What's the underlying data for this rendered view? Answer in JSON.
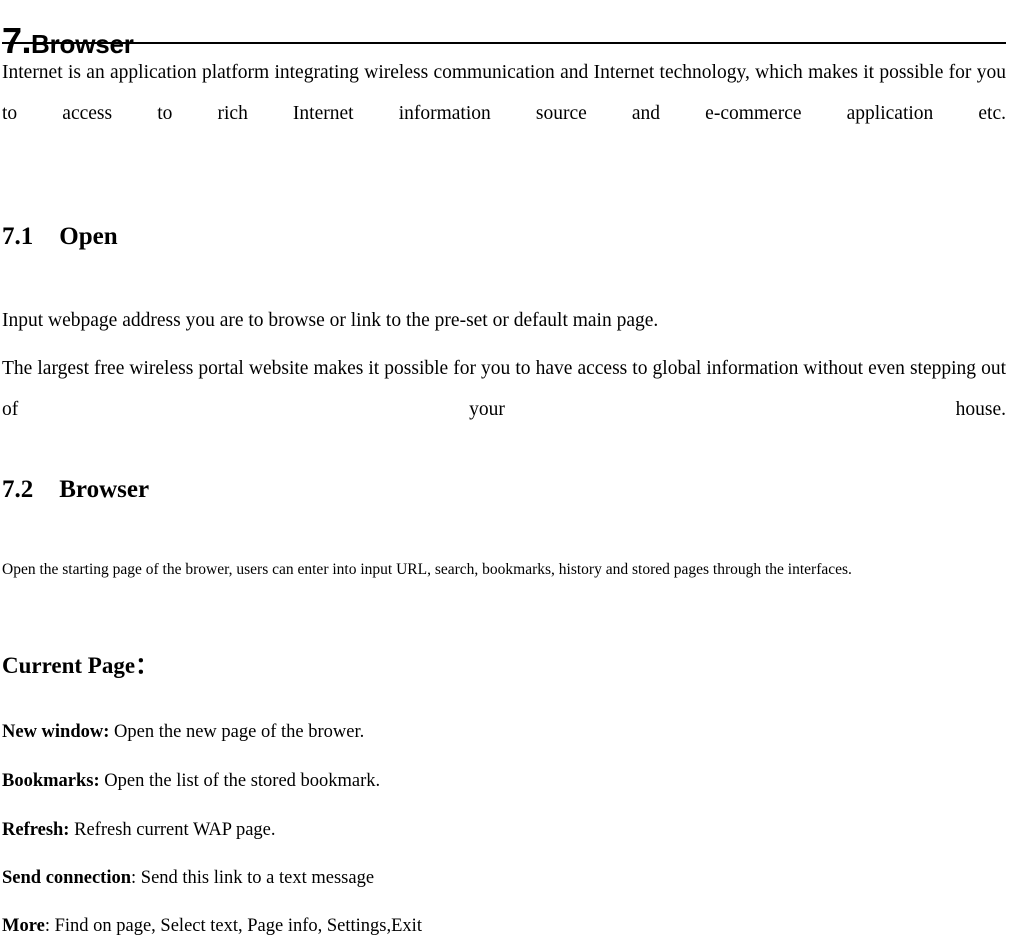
{
  "document": {
    "background_color": "#ffffff",
    "text_color": "#000000"
  },
  "chapter": {
    "number": "7.",
    "name": "Browser"
  },
  "intro_paragraph": "Internet is an application platform integrating wireless communication and Internet technology, which makes it possible for you to access to rich Internet information source and e-commerce application etc.",
  "sections": [
    {
      "number": "7.1",
      "title": "Open",
      "paragraphs": [
        "Input webpage address you are to browse or link to the pre-set or default main page.",
        "The largest free wireless portal website makes it possible for you to have access to global information without even stepping out of your house."
      ]
    },
    {
      "number": "7.2",
      "title": "Browser",
      "paragraphs": [
        "Open the starting page of the brower, users can enter into input URL, search, bookmarks, history and stored pages through the interfaces."
      ],
      "subheading": "Current Page：",
      "items": [
        {
          "term": "New window:",
          "desc": " Open the new page of the brower."
        },
        {
          "term": "Bookmarks:",
          "desc": " Open the list of the stored bookmark."
        },
        {
          "term": "Refresh:",
          "desc": " Refresh current WAP page."
        },
        {
          "term": "Send connection",
          "desc": ": Send this link to a text message"
        },
        {
          "term": "More",
          "desc": ": Find on page, Select text, Page info, Settings,Exit"
        }
      ]
    }
  ]
}
